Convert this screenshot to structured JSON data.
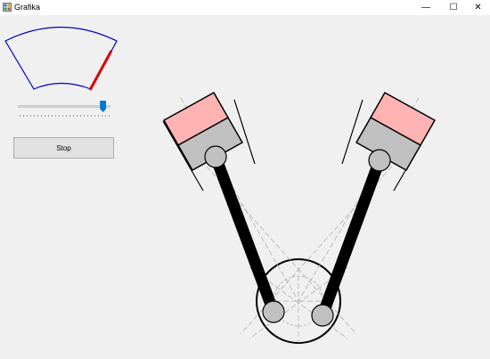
{
  "window": {
    "title": "Grafika",
    "minimize_glyph": "—",
    "maximize_glyph": "☐",
    "close_glyph": "✕"
  },
  "controls": {
    "stop_label": "Stop",
    "slider_value_fraction": 0.95
  },
  "gauge": {
    "outline_color": "#0000cc",
    "needle_color": "#dd0000"
  },
  "engine": {
    "piston_crown_color": "#ffb3b3",
    "piston_body_color": "#c0c0c0",
    "rod_color": "#000000",
    "pin_color": "#c0c0c0"
  }
}
